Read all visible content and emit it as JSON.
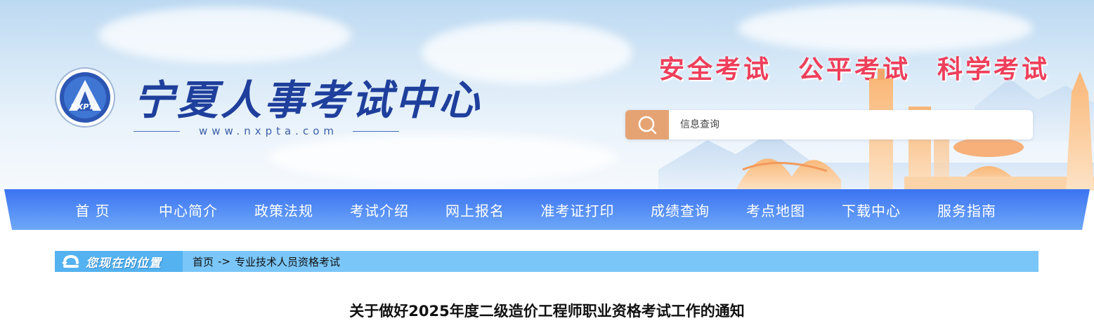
{
  "header": {
    "site_name": "宁夏人事考试中心",
    "logo_text": "NXPTA",
    "site_url": "www.nxpta.com",
    "slogans": [
      "安全考试",
      "公平考试",
      "科学考试"
    ],
    "search": {
      "placeholder": "信息查询",
      "icon": "search-icon"
    }
  },
  "nav": {
    "items": [
      {
        "label": "首  页"
      },
      {
        "label": "中心简介"
      },
      {
        "label": "政策法规"
      },
      {
        "label": "考试介绍"
      },
      {
        "label": "网上报名"
      },
      {
        "label": "准考证打印"
      },
      {
        "label": "成绩查询"
      },
      {
        "label": "考点地图"
      },
      {
        "label": "下载中心"
      },
      {
        "label": "服务指南"
      }
    ]
  },
  "breadcrumb": {
    "label": "您现在的位置",
    "home": "首页",
    "separator": "->",
    "current": "专业技术人员资格考试"
  },
  "article": {
    "title": "关于做好2025年度二级造价工程师职业资格考试工作的通知"
  },
  "colors": {
    "nav": "#4a86f5",
    "slogan": "#ee3f5a",
    "search_button": "#e5a374",
    "breadcrumb": "#7ac6f8"
  }
}
